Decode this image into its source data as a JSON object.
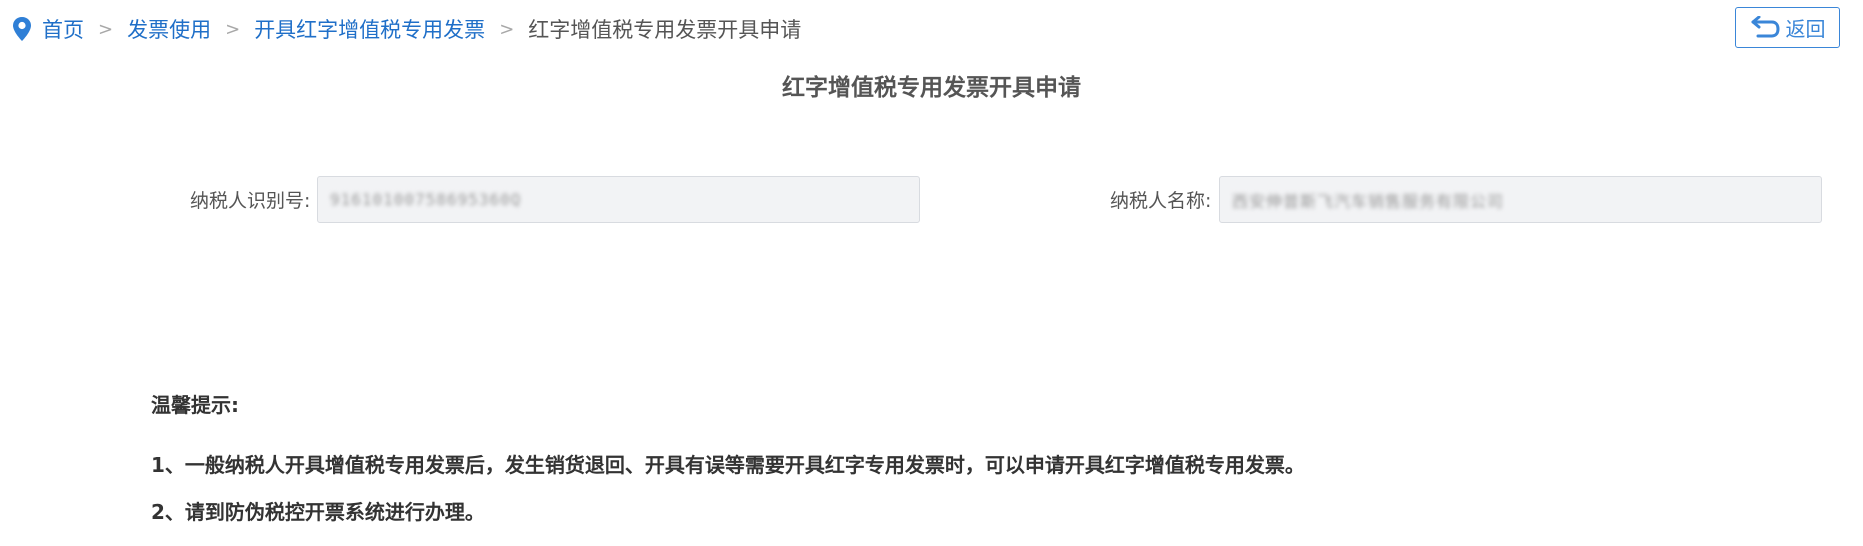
{
  "breadcrumb": {
    "items": [
      {
        "label": "首页"
      },
      {
        "label": "发票使用"
      },
      {
        "label": "开具红字增值税专用发票"
      }
    ],
    "current": "红字增值税专用发票开具申请",
    "separator": ">"
  },
  "header": {
    "back_label": "返回"
  },
  "title": "红字增值税专用发票开具申请",
  "form": {
    "taxpayer_id": {
      "label": "纳税人识别号:",
      "value": "91610100758695360Q"
    },
    "taxpayer_name": {
      "label": "纳税人名称:",
      "value": "西安伸普斯飞汽车销售服务有限公司"
    }
  },
  "tips": {
    "title": "温馨提示:",
    "lines": [
      "1、一般纳税人开具增值税专用发票后，发生销货退回、开具有误等需要开具红字专用发票时，可以申请开具红字增值税专用发票。",
      "2、请到防伪税控开票系统进行办理。"
    ]
  },
  "colors": {
    "link": "#1f6fc8",
    "accent": "#3a86d8",
    "input_bg": "#f2f3f5"
  }
}
